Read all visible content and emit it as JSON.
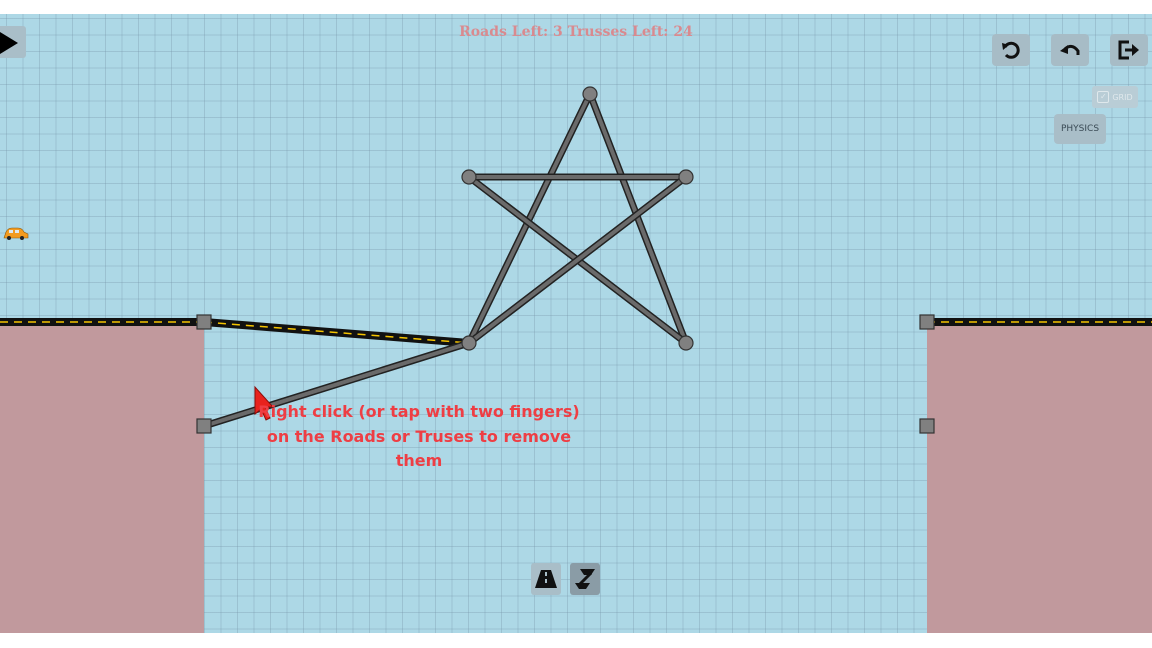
{
  "hud": {
    "counter_text": "Roads Left: 3 Trusses Left: 24"
  },
  "toolbar": {
    "play_icon": "play-icon",
    "restart_icon": "restart-icon",
    "undo_icon": "undo-icon",
    "exit_icon": "exit-icon"
  },
  "toggles": {
    "grid_label": "GRID",
    "grid_checked": true,
    "physics_label": "PHYSICS"
  },
  "hint_text": "Right click (or tap with two fingers) on the Roads or Truses to remove them",
  "build_tools": {
    "road_icon": "road-icon",
    "truss_icon": "truss-icon",
    "selected": "truss"
  },
  "colors": {
    "sky": "#add8e6",
    "ground": "#c1999d",
    "hint": "#ee3e44",
    "counter": "#d98a8f",
    "road_line": "#f5c400"
  }
}
